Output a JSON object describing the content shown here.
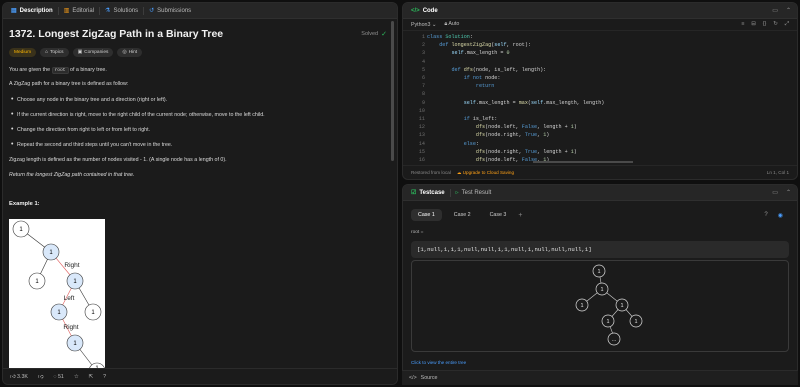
{
  "left_tabs": [
    "Description",
    "Editorial",
    "Solutions",
    "Submissions"
  ],
  "problem": {
    "title": "1372. Longest ZigZag Path in a Binary Tree",
    "status": "Solved",
    "difficulty": "Medium",
    "pills": [
      "Topics",
      "Companies",
      "Hint"
    ],
    "intro_pre": "You are given the",
    "intro_code": "root",
    "intro_post": "of a binary tree.",
    "def": "A ZigZag path for a binary tree is defined as follow:",
    "bullets": [
      "Choose any node in the binary tree and a direction (right or left).",
      "If the current direction is right, move to the right child of the current node; otherwise, move to the left child.",
      "Change the direction from right to left or from left to right.",
      "Repeat the second and third steps until you can't move in the tree."
    ],
    "length_note": "Zigzag length is defined as the number of nodes visited - 1. (A single node has a length of 0).",
    "return_text": "Return the longest ZigZag path contained in that tree.",
    "example_label": "Example 1:",
    "tree_labels": [
      "Right",
      "Left",
      "Right"
    ],
    "node_value": "1"
  },
  "footer": {
    "likes": "3.3K",
    "comments": "51"
  },
  "code_panel": {
    "title": "Code",
    "language": "Python3",
    "mode": "Auto",
    "restored": "Restored from local",
    "upgrade": "Upgrade to Cloud Saving",
    "position": "Ln 1, Col 1",
    "lines": [
      "class Solution:",
      "    def longestZigZag(self, root):",
      "        self.max_length = 0",
      "",
      "        def dfs(node, is_left, length):",
      "            if not node:",
      "                return",
      "",
      "            self.max_length = max(self.max_length, length)",
      "",
      "            if is_left:",
      "                dfs(node.left, False, length + 1)",
      "                dfs(node.right, True, 1)",
      "            else:",
      "                dfs(node.right, True, length + 1)",
      "                dfs(node.left, False, 1)"
    ]
  },
  "test_panel": {
    "tabs": [
      "Testcase",
      "Test Result"
    ],
    "cases": [
      "Case 1",
      "Case 2",
      "Case 3"
    ],
    "root_label": "root =",
    "root_value": "[1,null,1,1,1,null,null,1,1,null,1,null,null,null,1]",
    "view_link": "Click to view the entire tree",
    "more": "..."
  },
  "source_label": "Source",
  "colors": {
    "accent": "#ffa116",
    "easy_green": "#2cbb5d",
    "medium": "#ffb800",
    "link": "#4a9eff"
  }
}
